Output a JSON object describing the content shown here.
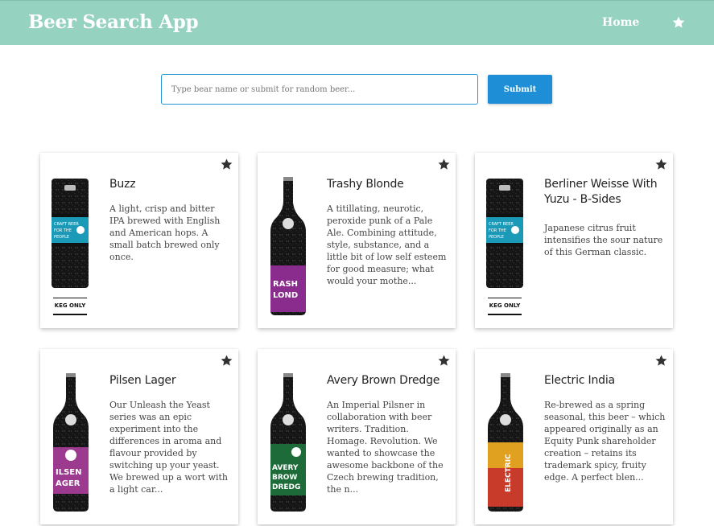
{
  "header": {
    "title": "Beer Search App",
    "nav_home": "Home",
    "nav_favourites_icon": "star-icon"
  },
  "search": {
    "placeholder": "Type bear name or submit for random beer...",
    "value": "",
    "submit_label": "Submit"
  },
  "colors": {
    "header_bg": "#95d2c0",
    "accent": "#1e8fd6",
    "star": "#333333"
  },
  "beers": [
    {
      "name": "Buzz",
      "description": "A light, crisp and bitter IPA brewed with English and American hops. A small batch brewed only once.",
      "image": "keg",
      "badge": "KEG ONLY"
    },
    {
      "name": "Trashy Blonde",
      "description": "A titillating, neurotic, peroxide punk of a Pale Ale. Combining attitude, style, substance, and a little bit of low self esteem for good measure; what would your mothe...",
      "image": "bottle",
      "label_text": "TRASHY BLONDE"
    },
    {
      "name": "Berliner Weisse With Yuzu - B-Sides",
      "description": "Japanese citrus fruit intensifies the sour nature of this German classic.",
      "image": "keg",
      "badge": "KEG ONLY"
    },
    {
      "name": "Pilsen Lager",
      "description": "Our Unleash the Yeast series was an epic experiment into the differences in aroma and flavour provided by switching up your yeast. We brewed up a wort with a light car...",
      "image": "bottle",
      "label_text": "PILSEN LAGER"
    },
    {
      "name": "Avery Brown Dredge",
      "description": "An Imperial Pilsner in collaboration with beer writers. Tradition. Homage. Revolution. We wanted to showcase the awesome backbone of the Czech brewing tradition, the n...",
      "image": "bottle",
      "label_text": "AVERY BROWN DREDGE"
    },
    {
      "name": "Electric India",
      "description": "Re-brewed as a spring seasonal, this beer – which appeared originally as an Equity Punk shareholder creation – retains its trademark spicy, fruity edge. A perfect blen...",
      "image": "bottle",
      "label_text": "ELECTRIC INDIA"
    }
  ]
}
